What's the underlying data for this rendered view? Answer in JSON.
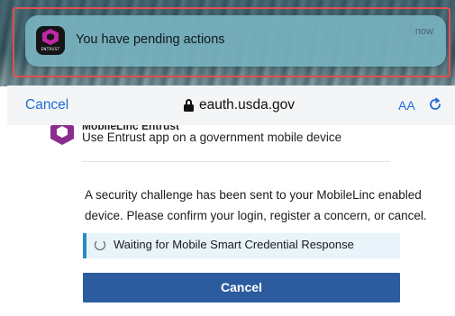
{
  "notification": {
    "app_brand": "ENTRUST",
    "message": "You have pending actions",
    "time": "now"
  },
  "browser": {
    "cancel_label": "Cancel",
    "url": "eauth.usda.gov",
    "text_size_label": "AA"
  },
  "page": {
    "auth_option_title": "MobileLinc Entrust",
    "auth_option_subtitle": "Use Entrust app on a government mobile device",
    "message": "A security challenge has been sent to your MobileLinc enabled device. Please confirm your login, register a concern, or cancel.",
    "status_text": "Waiting for Mobile Smart Credential Response",
    "cancel_button_label": "Cancel"
  },
  "colors": {
    "accent_link": "#1f6bd6",
    "button_primary": "#2c5c9e",
    "status_border": "#2b8cc4",
    "highlight_border": "#e0504d",
    "brand_purple": "#8a2d8f"
  },
  "icons": [
    "entrust-app-icon",
    "lock-icon",
    "reload-icon",
    "entrust-logo-icon",
    "spinner-icon"
  ]
}
